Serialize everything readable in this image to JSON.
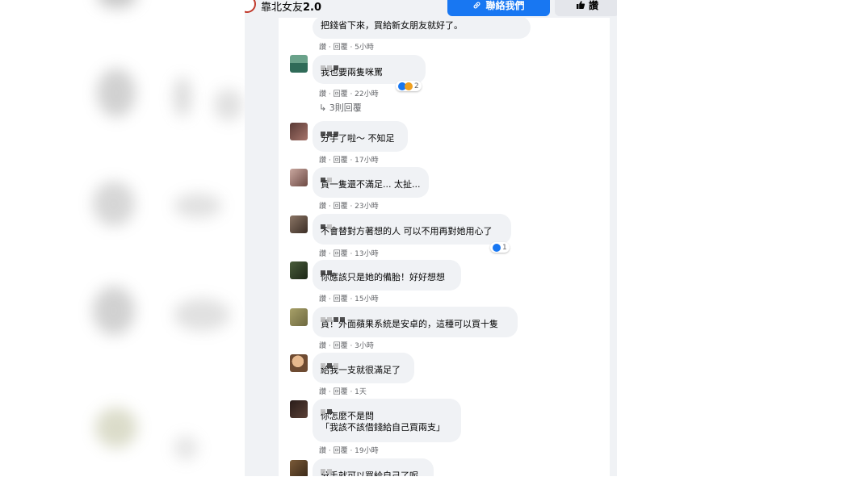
{
  "header": {
    "page_name_prefix": "靠北女友",
    "page_name_version": "2.0",
    "contact_label": "聯絡我們",
    "like_label": "讚"
  },
  "comments": [
    {
      "text": "把錢省下來，買給新女朋友就好了。",
      "meta": "讚 · 回覆 · 5小時"
    },
    {
      "text": "我也要兩隻咪罵",
      "meta": "讚 · 回覆 · 22小時",
      "reactions": "2",
      "replies": "3則回覆"
    },
    {
      "text": "分手了啦～ 不知足",
      "meta": "讚 · 回覆 · 17小時"
    },
    {
      "text": "買一隻還不滿足... 太扯...",
      "meta": "讚 · 回覆 · 23小時"
    },
    {
      "text": "不會替對方著想的人 可以不用再對她用心了",
      "meta": "讚 · 回覆 · 13小時",
      "reactions": "1"
    },
    {
      "text": "你應該只是她的備胎！好好想想",
      "meta": "讚 · 回覆 · 15小時"
    },
    {
      "text": "買！外面蘋果系統是安卓的，這種可以買十隻",
      "meta": "讚 · 回覆 · 3小時"
    },
    {
      "text": "給我一支就很滿足了",
      "meta": "讚 · 回覆 · 1天"
    },
    {
      "text": "你怎麼不是問",
      "text2": "「我該不該借錢給自己買兩支」",
      "meta": "讚 · 回覆 · 19小時"
    },
    {
      "text": "分手就可以買給自己了呢"
    }
  ]
}
